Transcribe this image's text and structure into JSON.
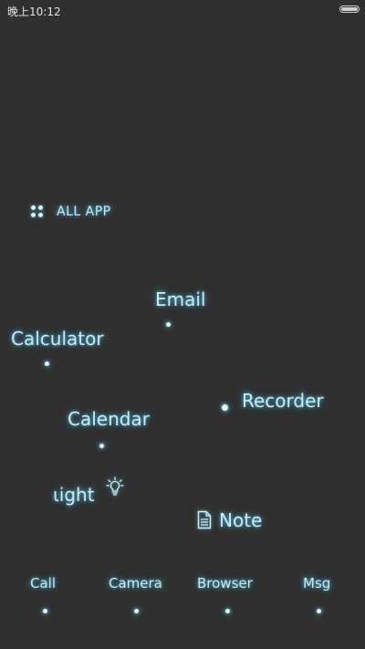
{
  "status_bar": {
    "time": "晚上10:12",
    "battery_level": 1.0
  },
  "launcher": {
    "all_app_label": "ALL APP",
    "apps": {
      "email": "Email",
      "calculator": "Calculator",
      "recorder": "Recorder",
      "calendar": "Calendar",
      "light": "ιight",
      "note": "Note"
    }
  },
  "dock": {
    "call": "Call",
    "camera": "Camera",
    "browser": "Browser",
    "msg": "Msg"
  },
  "colors": {
    "background": "#303030",
    "glow": "#5ac8eb",
    "text": "#c7eef8"
  },
  "icons": [
    "four-dots-grid-icon",
    "lightbulb-icon",
    "document-icon",
    "battery-icon"
  ]
}
